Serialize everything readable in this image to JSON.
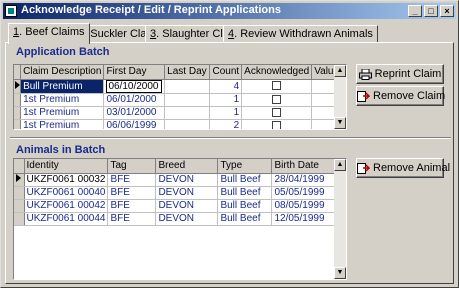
{
  "window": {
    "title": "Acknowledge Receipt / Edit / Reprint Applications",
    "controls": [
      "_",
      "□",
      "×"
    ]
  },
  "tabs": [
    {
      "key": "1",
      "label": ". Beef Claims",
      "active": true
    },
    {
      "key": "2",
      "label": ". Suckler Claims",
      "active": false
    },
    {
      "key": "3",
      "label": ". Slaughter Claims",
      "active": false
    },
    {
      "key": "4",
      "label": ". Review Withdrawn Animals",
      "active": false
    }
  ],
  "application_batch": {
    "label": "Application Batch",
    "columns": [
      "Claim Description",
      "First Day",
      "Last Day",
      "Count",
      "Acknowledged",
      "Value"
    ],
    "rows": [
      {
        "description": "Bull Premium",
        "first_day": "06/10/2000",
        "last_day": "",
        "count": "4",
        "acknowledged": false,
        "value": ""
      },
      {
        "description": "1st Premium",
        "first_day": "06/01/2000",
        "last_day": "",
        "count": "1",
        "acknowledged": false,
        "value": ""
      },
      {
        "description": "1st Premium",
        "first_day": "03/01/2000",
        "last_day": "",
        "count": "1",
        "acknowledged": false,
        "value": ""
      },
      {
        "description": "1st Premium",
        "first_day": "06/06/1999",
        "last_day": "",
        "count": "2",
        "acknowledged": false,
        "value": ""
      }
    ],
    "buttons": {
      "reprint": "Reprint Claim",
      "remove": "Remove Claim"
    }
  },
  "animals_in_batch": {
    "label": "Animals in Batch",
    "columns": [
      "Identity",
      "Tag",
      "Breed",
      "Type",
      "Birth Date"
    ],
    "rows": [
      {
        "identity": "UKZF0061 00032",
        "tag": "BFE",
        "breed": "DEVON",
        "type": "Bull Beef",
        "birth_date": "28/04/1999"
      },
      {
        "identity": "UKZF0061 00040",
        "tag": "BFE",
        "breed": "DEVON",
        "type": "Bull Beef",
        "birth_date": "05/05/1999"
      },
      {
        "identity": "UKZF0061 00042",
        "tag": "BFE",
        "breed": "DEVON",
        "type": "Bull Beef",
        "birth_date": "08/05/1999"
      },
      {
        "identity": "UKZF0061 00044",
        "tag": "BFE",
        "breed": "DEVON",
        "type": "Bull Beef",
        "birth_date": "12/05/1999"
      }
    ],
    "buttons": {
      "remove": "Remove Animal"
    }
  },
  "colors": {
    "title_start": "#0a246a",
    "title_end": "#a6caf0",
    "section_label": "#1a2b8c",
    "cell_text": "#1a2b8c"
  },
  "icons": {
    "reprint": "printer-icon",
    "remove_claim": "remove-doc-icon",
    "remove_animal": "remove-doc-icon"
  }
}
